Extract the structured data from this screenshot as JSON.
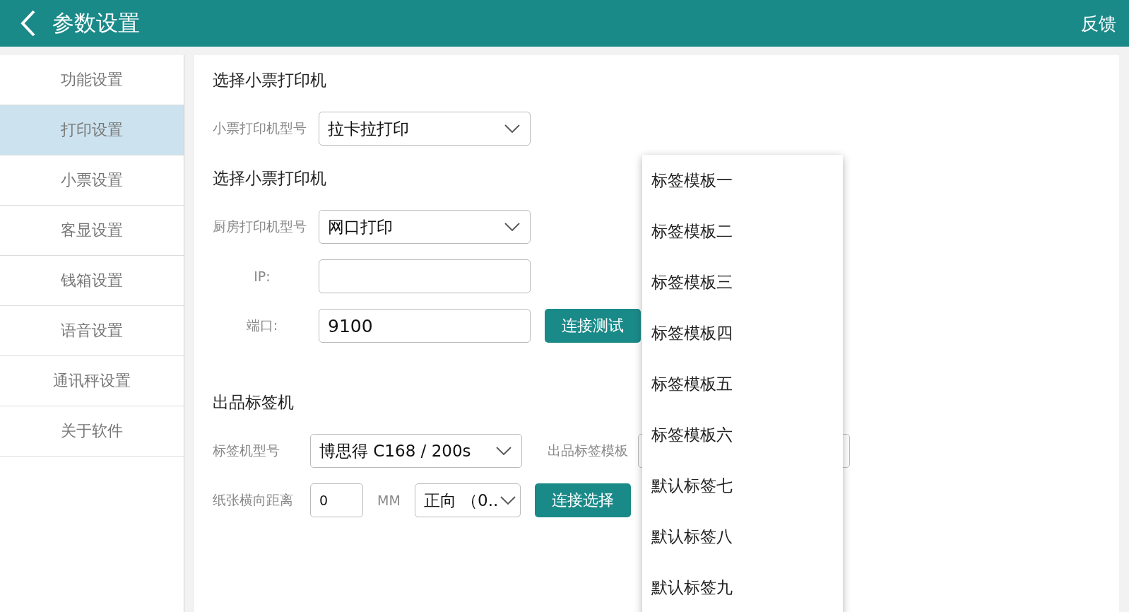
{
  "header": {
    "title": "参数设置",
    "action": "反馈"
  },
  "sidebar": {
    "items": [
      {
        "label": "功能设置",
        "selected": false
      },
      {
        "label": "打印设置",
        "selected": true
      },
      {
        "label": "小票设置",
        "selected": false
      },
      {
        "label": "客显设置",
        "selected": false
      },
      {
        "label": "钱箱设置",
        "selected": false
      },
      {
        "label": "语音设置",
        "selected": false
      },
      {
        "label": "通讯秤设置",
        "selected": false
      },
      {
        "label": "关于软件",
        "selected": false
      }
    ]
  },
  "receipt_printer": {
    "heading": "选择小票打印机",
    "model_label": "小票打印机型号",
    "model_value": "拉卡拉打印"
  },
  "kitchen_printer": {
    "heading": "选择小票打印机",
    "model_label": "厨房打印机型号",
    "model_value": "网口打印",
    "ip_label": "IP:",
    "port_label": "端口:",
    "port_value": "9100",
    "test_button": "连接测试"
  },
  "label_printer": {
    "heading": "出品标签机",
    "model_label": "标签机型号",
    "model_value": "博思得 C168 / 200s",
    "template_label": "出品标签模板",
    "offset_label": "纸张横向距离",
    "offset_value": "0",
    "unit": "MM",
    "direction_value": "正向 （0..",
    "select_button": "连接选择"
  },
  "dropdown_menu": {
    "items": [
      "标签模板一",
      "标签模板二",
      "标签模板三",
      "标签模板四",
      "标签模板五",
      "标签模板六",
      "默认标签七",
      "默认标签八",
      "默认标签九"
    ]
  }
}
